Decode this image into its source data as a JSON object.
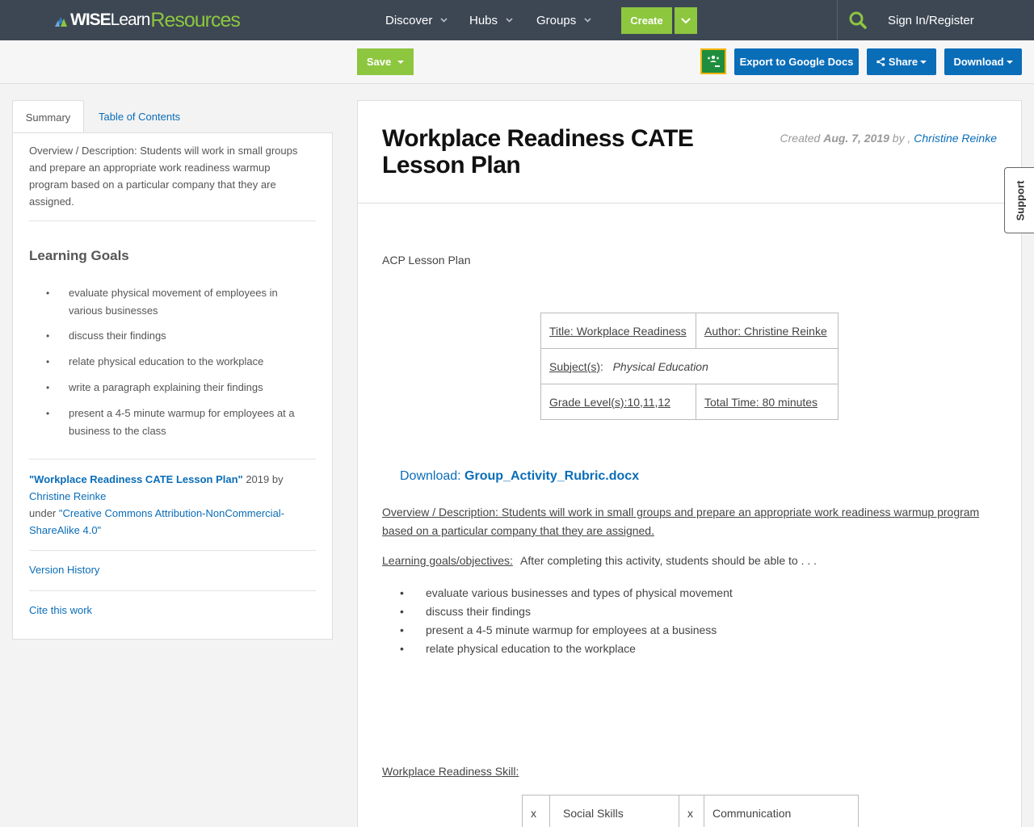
{
  "brand": {
    "wise": "WISE",
    "learn": "Learn",
    "resources": "Resources"
  },
  "nav": {
    "discover": "Discover",
    "hubs": "Hubs",
    "groups": "Groups",
    "create": "Create",
    "signin": "Sign In/Register"
  },
  "toolbar": {
    "save": "Save",
    "export": "Export to Google Docs",
    "share": "Share",
    "download": "Download"
  },
  "sidebar": {
    "tabs": [
      "Summary",
      "Table of Contents"
    ],
    "description": "Overview / Description: Students will work in small groups and prepare an appropriate work readiness warmup program based on a particular company that they are assigned.",
    "learning_goals_title": "Learning Goals",
    "learning_goals": [
      "evaluate physical movement of employees in various businesses",
      "discuss their findings",
      "relate physical education to the workplace",
      "write a paragraph explaining their findings",
      "present a 4-5 minute warmup for employees at a business to the class"
    ],
    "attribution": {
      "work_title": "\"Workplace Readiness CATE Lesson Plan\"",
      "year_by": " 2019 by ",
      "author": "Christine Reinke",
      "under": "under ",
      "license": "\"Creative Commons Attribution-NonCommercial-ShareAlike 4.0\""
    },
    "version_history": "Version History",
    "cite": "Cite this work"
  },
  "main": {
    "title": "Workplace Readiness CATE Lesson Plan",
    "created_label": "Created ",
    "created_date": "Aug. 7, 2019",
    "by": " by , ",
    "author": "Christine Reinke",
    "acp": "ACP Lesson Plan",
    "info_table": {
      "title": "Title:  Workplace Readiness",
      "author": "Author:  Christine Reinke",
      "subject_label": "Subject(s)",
      "subject_colon": ":   ",
      "subject_value": "Physical Education",
      "grade": "Grade Level(s):10,11,12",
      "time": "Total Time: 80 minutes"
    },
    "download_label": "Download: ",
    "download_file": "Group_Activity_Rubric.docx",
    "overview": "Overview / Description:  Students will work in small groups and prepare an appropriate work readiness warmup program based on a particular company that they are assigned.",
    "lgo_label": "Learning goals/objectives:",
    "lgo_text": "  After completing this activity, students should be able to . . .",
    "objectives": [
      "evaluate various businesses and types of physical movement",
      "discuss their findings",
      "present a 4-5 minute warmup for employees at a business",
      "relate physical education to the workplace"
    ],
    "wrs": "Workplace Readiness Skill:",
    "skills": [
      {
        "mark": "x",
        "name": "Social Skills"
      },
      {
        "mark": "x",
        "name": "Communication"
      }
    ]
  },
  "support": "Support",
  "colors": {
    "nav_bg": "#3d4754",
    "green": "#8dc63f",
    "blue": "#0a6db8"
  }
}
